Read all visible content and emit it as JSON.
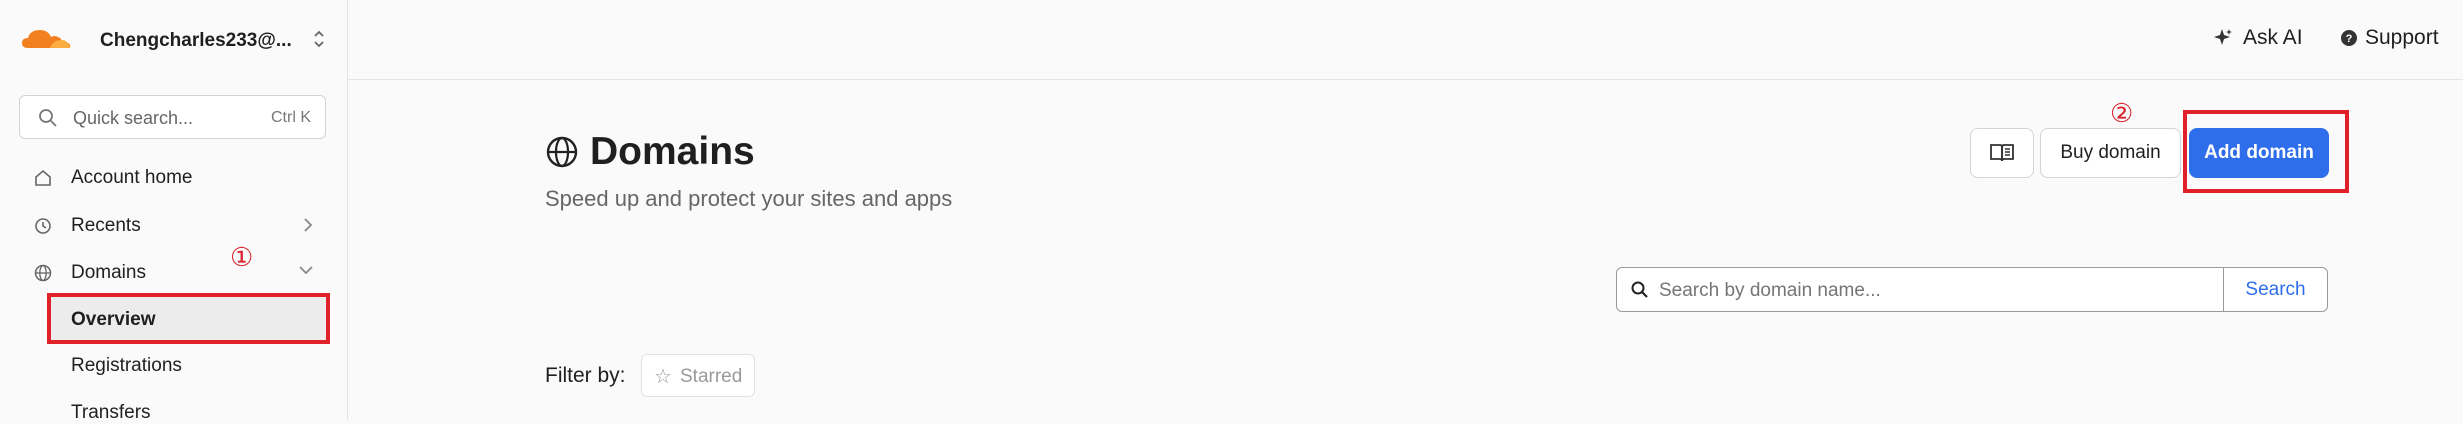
{
  "account": {
    "name": "Chengcharles233@...",
    "chevron_icon": "chevron-up-down-icon"
  },
  "quick_search": {
    "placeholder": "Quick search...",
    "shortcut": "Ctrl K"
  },
  "sidebar": {
    "items": [
      {
        "label": "Account home",
        "icon": "home-icon"
      },
      {
        "label": "Recents",
        "icon": "history-icon"
      },
      {
        "label": "Domains",
        "icon": "globe-icon"
      }
    ],
    "domains_children": [
      "Overview",
      "Registrations",
      "Transfers"
    ]
  },
  "annotations": {
    "marker_1": "①",
    "marker_2": "②"
  },
  "header": {
    "ask_ai": "Ask AI",
    "support": "Support"
  },
  "main": {
    "title": "Domains",
    "subtitle": "Speed up and protect your sites and apps",
    "buy_domain": "Buy domain",
    "add_domain": "Add domain",
    "search_placeholder": "Search by domain name...",
    "search_button": "Search",
    "filter_label": "Filter by:",
    "starred_filter": "Starred"
  },
  "colors": {
    "brand": "#f38020",
    "accent": "#2f6eea",
    "highlight": "#e0212a"
  }
}
